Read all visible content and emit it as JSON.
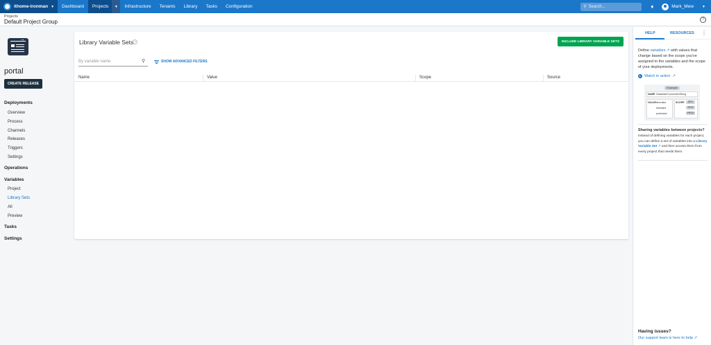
{
  "topnav": {
    "space_name": "ithome-ironman",
    "items": [
      "Dashboard",
      "Projects",
      "Infrastructure",
      "Tenants",
      "Library",
      "Tasks",
      "Configuration"
    ],
    "search_placeholder": "Search...",
    "user_name": "Mark_Mew"
  },
  "header": {
    "breadcrumb": "Projects",
    "project_group": "Default Project Group"
  },
  "sidebar": {
    "project_name": "portal",
    "create_release": "CREATE RELEASE",
    "deployments": "Deployments",
    "deployment_items": [
      "Overview",
      "Process",
      "Channels",
      "Releases",
      "Triggers",
      "Settings"
    ],
    "operations": "Operations",
    "variables": "Variables",
    "variable_items": [
      "Project",
      "Library Sets",
      "All",
      "Preview"
    ],
    "tasks": "Tasks",
    "settings": "Settings"
  },
  "main": {
    "title": "Library Variable Sets",
    "include_button": "INCLUDE LIBRARY VARIABLE SETS",
    "filter_placeholder": "By variable name",
    "advanced_filters": "SHOW ADVANCED FILTERS",
    "columns": [
      "Name",
      "Value",
      "Scope",
      "Source"
    ]
  },
  "help": {
    "tab_help": "HELP",
    "tab_resources": "RESOURCES",
    "define_pre": "Define ",
    "define_link": "variables",
    "define_post": " with values that change based on the scope you've assigned to the variables and the scope of your deployments.",
    "watch": "Watch in action",
    "example": {
      "tag": "Example",
      "name_label": "NAME",
      "name_value": "DatabaseConnectionString",
      "value_label": "VALUE",
      "values": [
        "devvalue",
        "testvalue",
        "prodvalue"
      ],
      "scope_label": "SCOPE",
      "scopes": [
        "DEV",
        "TEST",
        "PROD"
      ]
    },
    "sharing_title": "Sharing variables between projects?",
    "sharing_pre": "Instead of defining variables for each project, you can define a set of variables into a ",
    "sharing_link": "Library Variable Set",
    "sharing_post": " and then access them from every project that needs them.",
    "issues_title": "Having issues?",
    "issues_link": "Our support team is here to help"
  },
  "colors": {
    "nav_blue": "#1a77ca",
    "nav_dark": "#0d4d8c",
    "green": "#00a550",
    "dark_btn": "#1f303d"
  }
}
